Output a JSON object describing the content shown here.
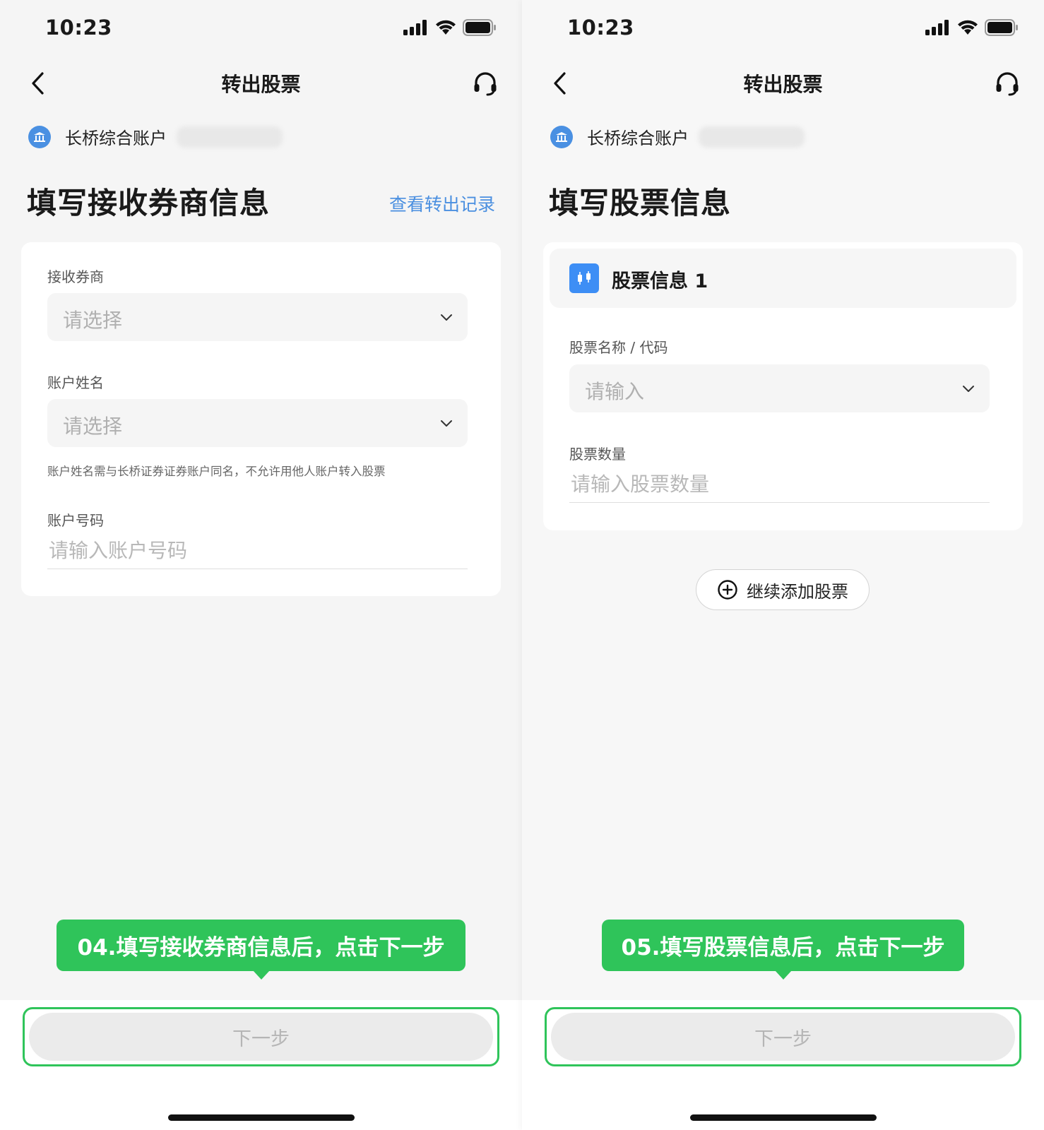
{
  "status_bar": {
    "time": "10:23"
  },
  "left": {
    "nav_title": "转出股票",
    "account_name": "长桥综合账户",
    "section_title": "填写接收券商信息",
    "record_link": "查看转出记录",
    "broker": {
      "label": "接收券商",
      "placeholder": "请选择"
    },
    "account_holder": {
      "label": "账户姓名",
      "placeholder": "请选择",
      "hint": "账户姓名需与长桥证券证券账户同名，不允许用他人账户转入股票"
    },
    "account_number": {
      "label": "账户号码",
      "placeholder": "请输入账户号码"
    },
    "tooltip": "04.填写接收券商信息后，点击下一步",
    "next_button": "下一步"
  },
  "right": {
    "nav_title": "转出股票",
    "account_name": "长桥综合账户",
    "section_title": "填写股票信息",
    "stock_card_title": "股票信息 1",
    "stock_name": {
      "label": "股票名称 / 代码",
      "placeholder": "请输入"
    },
    "stock_quantity": {
      "label": "股票数量",
      "placeholder": "请输入股票数量"
    },
    "add_stock_button": "继续添加股票",
    "tooltip": "05.填写股票信息后，点击下一步",
    "next_button": "下一步"
  },
  "colors": {
    "accent_green": "#2fc45a",
    "link_blue": "#4a8fe0",
    "stock_icon_blue": "#3d8ef5",
    "bank_icon_blue": "#4a90e2"
  },
  "icons": [
    "back-arrow-icon",
    "headset-icon",
    "bank-icon",
    "chevron-down-icon",
    "stock-chart-icon",
    "plus-circle-icon",
    "signal-icon",
    "wifi-icon",
    "battery-icon"
  ]
}
